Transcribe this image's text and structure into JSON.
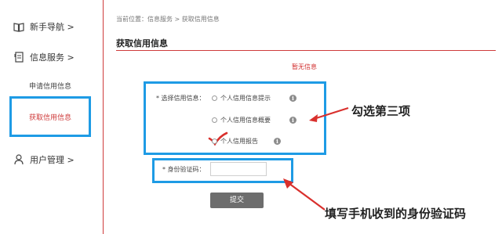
{
  "sidebar": {
    "items": [
      {
        "label": "新手导航 >",
        "icon": "book-icon"
      },
      {
        "label": "信息服务 >",
        "icon": "document-icon"
      },
      {
        "label": "用户管理 >",
        "icon": "user-icon"
      }
    ],
    "sub_items": [
      {
        "label": "申请信用信息"
      },
      {
        "label": "获取信用信息",
        "active": true
      }
    ]
  },
  "breadcrumb": "当前位置：信息服务 > 获取信用信息",
  "page_title": "获取信用信息",
  "notice": "暂无信息",
  "form": {
    "select_label": "* 选择信用信息：",
    "options": [
      {
        "label": "个人信用信息提示",
        "selected": false
      },
      {
        "label": "个人信用信息概要",
        "selected": false
      },
      {
        "label": "个人信用报告",
        "selected": true
      }
    ],
    "id_code_label": "* 身份验证码：",
    "id_code_value": "",
    "submit_label": "提交"
  },
  "annotations": {
    "select_hint": "勾选第三项",
    "code_hint": "填写手机收到的身份验证码"
  },
  "colors": {
    "accent_red": "#cf3b3b",
    "highlight_blue": "#1e9be5",
    "arrow_red": "#d9302d"
  }
}
